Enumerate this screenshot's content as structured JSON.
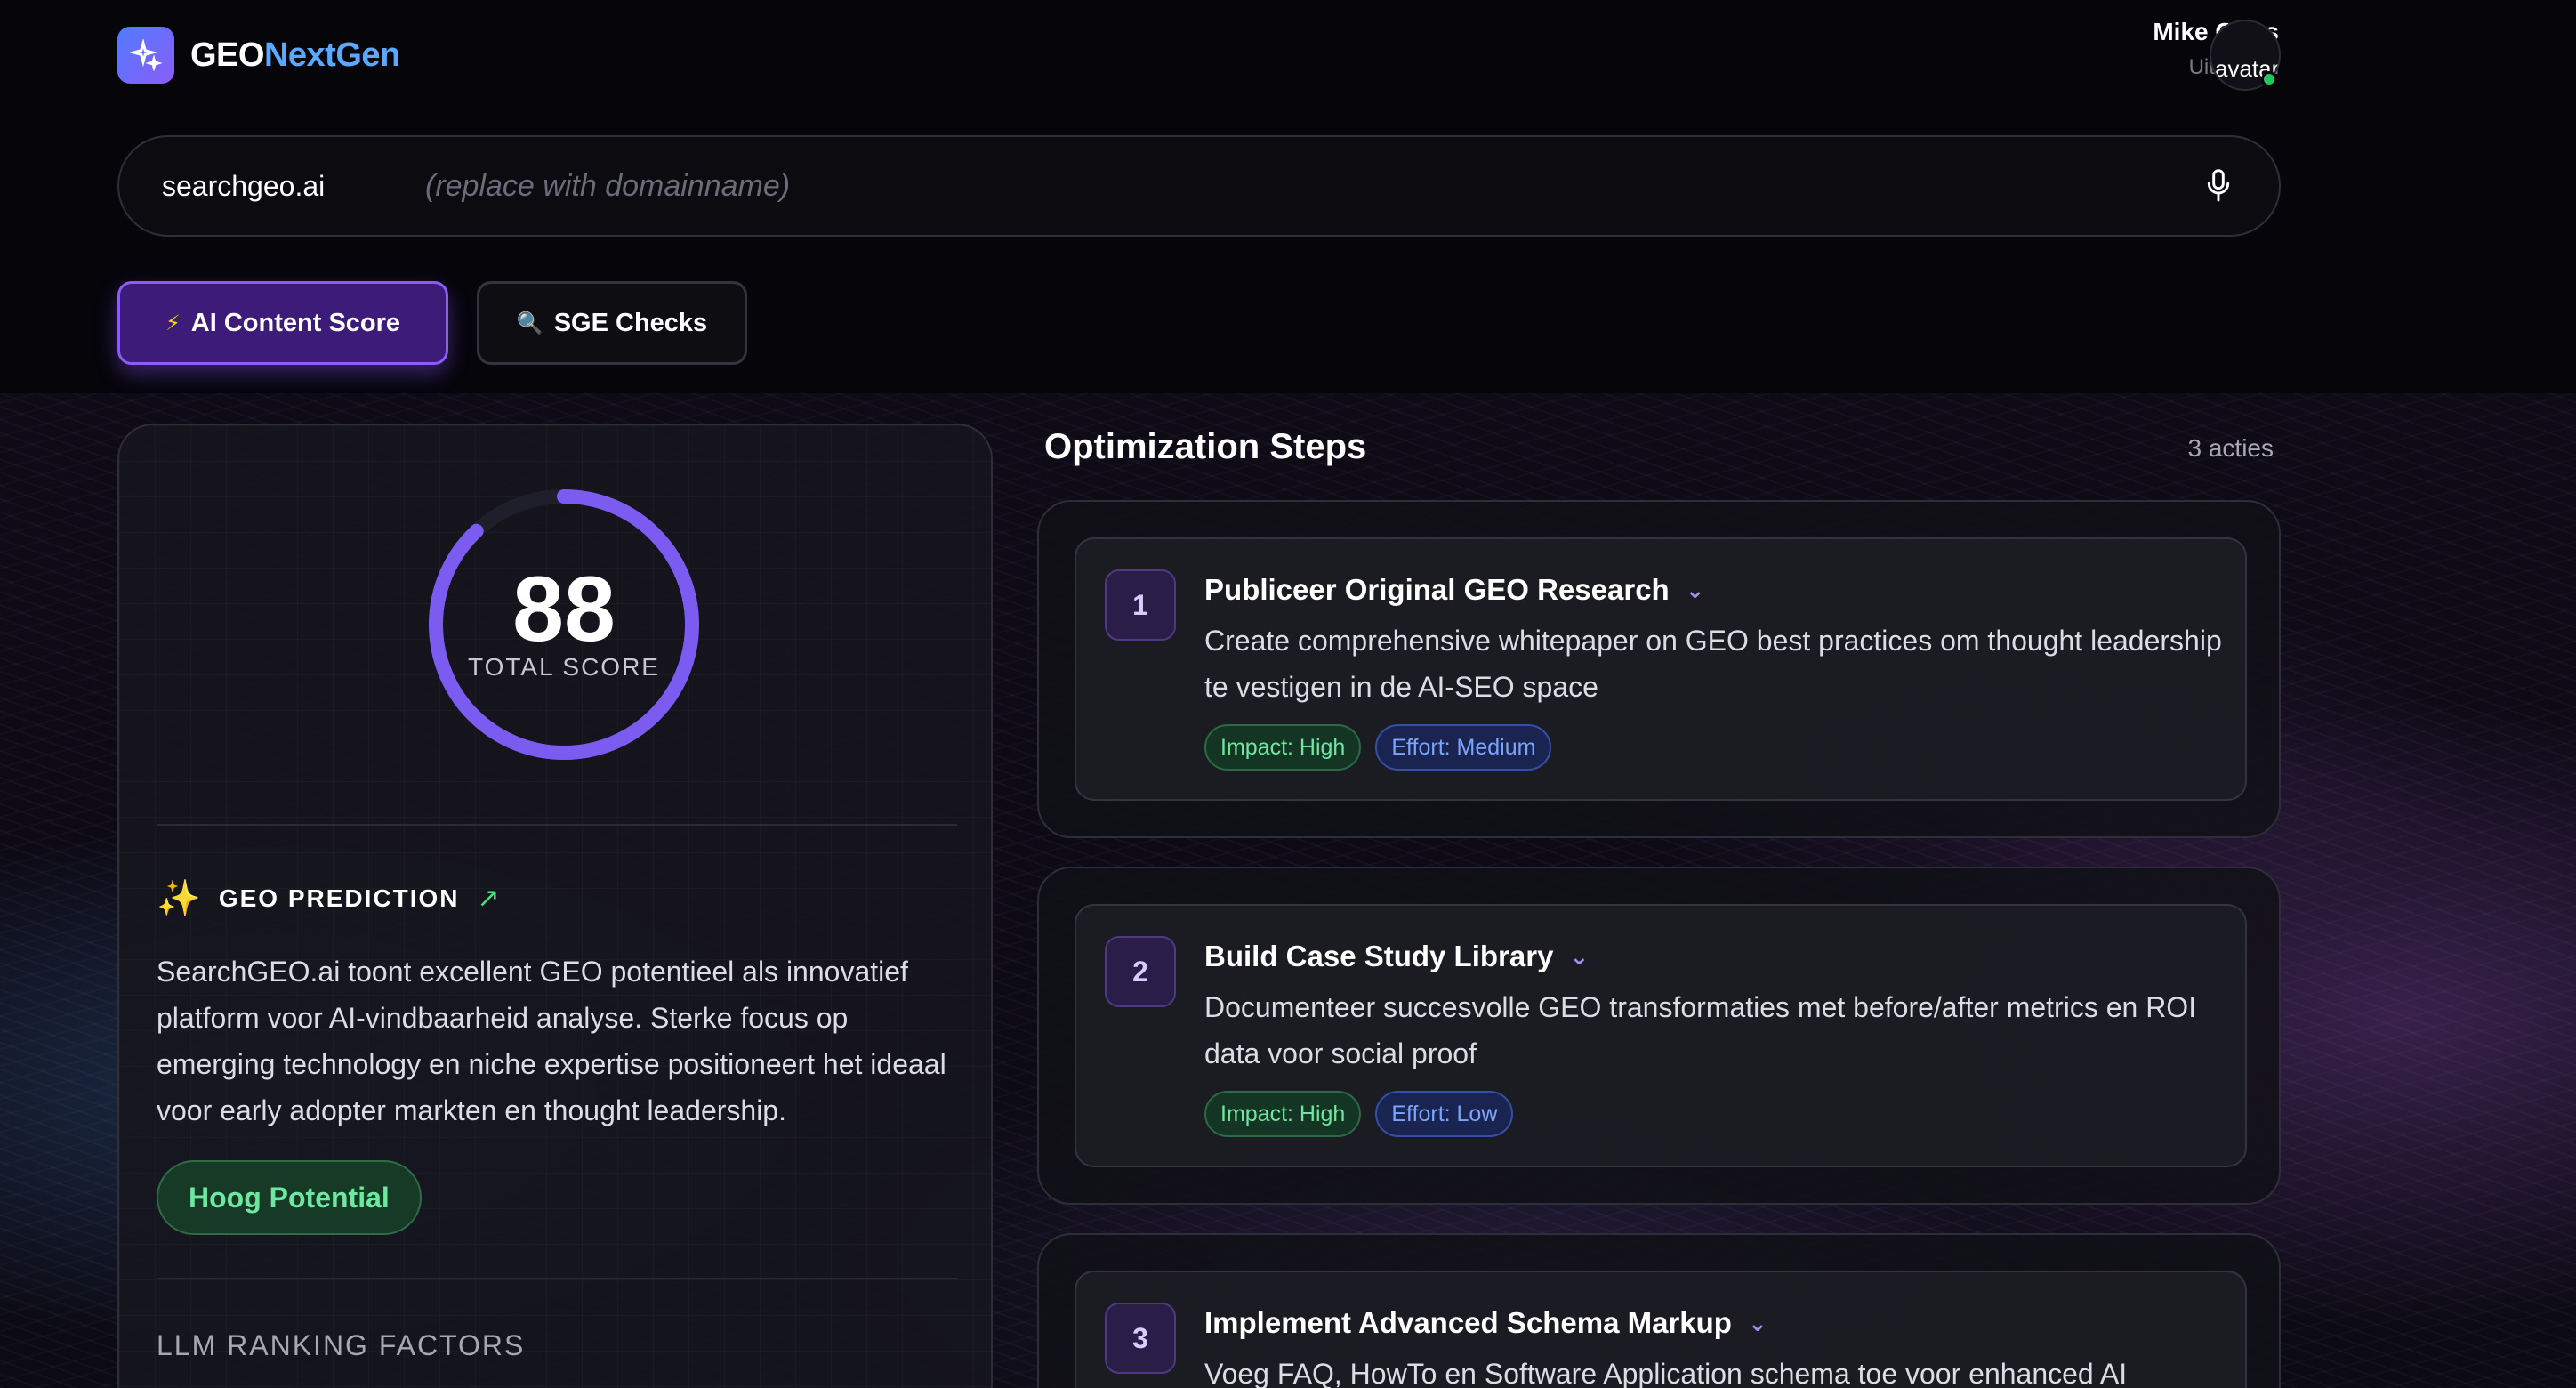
{
  "header": {
    "logo_part1": "GEO",
    "logo_part2": "NextGen",
    "logo_icon": "sparkle-icon",
    "user_name": "Mike Gries",
    "logout_label": "Uitloggen",
    "avatar_alt": "avatar"
  },
  "search": {
    "value": "searchgeo.ai",
    "placeholder": "(replace with domainname)"
  },
  "tabs": [
    {
      "icon": "⚡",
      "label": "AI Content Score",
      "active": true
    },
    {
      "icon": "🔍",
      "label": "SGE Checks",
      "active": false
    }
  ],
  "score": {
    "value": "88",
    "label": "TOTAL SCORE",
    "fraction": 0.88,
    "ring_color": "#7c5cf0"
  },
  "prediction": {
    "title": "GEO PREDICTION",
    "text": "SearchGEO.ai toont excellent GEO potentieel als innovatief platform voor AI-vindbaarheid analyse. Sterke focus op emerging technology en niche expertise positioneert het ideaal voor early adopter markten en thought leadership.",
    "badge": "Hoog Potential"
  },
  "llm_title": "LLM RANKING FACTORS",
  "optimization": {
    "title": "Optimization Steps",
    "count": "3 acties",
    "steps": [
      {
        "num": "1",
        "title": "Publiceer Original GEO Research",
        "desc": "Create comprehensive whitepaper on GEO best practices om thought leadership te vestigen in de AI-SEO space",
        "impact": "Impact: High",
        "effort": "Effort: Medium"
      },
      {
        "num": "2",
        "title": "Build Case Study Library",
        "desc": "Documenteer succesvolle GEO transformaties met before/after metrics en ROI data voor social proof",
        "impact": "Impact: High",
        "effort": "Effort: Low"
      },
      {
        "num": "3",
        "title": "Implement Advanced Schema Markup",
        "desc": "Voeg FAQ, HowTo en Software Application schema toe voor enhanced AI",
        "impact": "",
        "effort": ""
      }
    ]
  },
  "colors": {
    "accent": "#8b5cf6",
    "brand_blue": "#5aa9ff",
    "success": "#4ade80"
  }
}
